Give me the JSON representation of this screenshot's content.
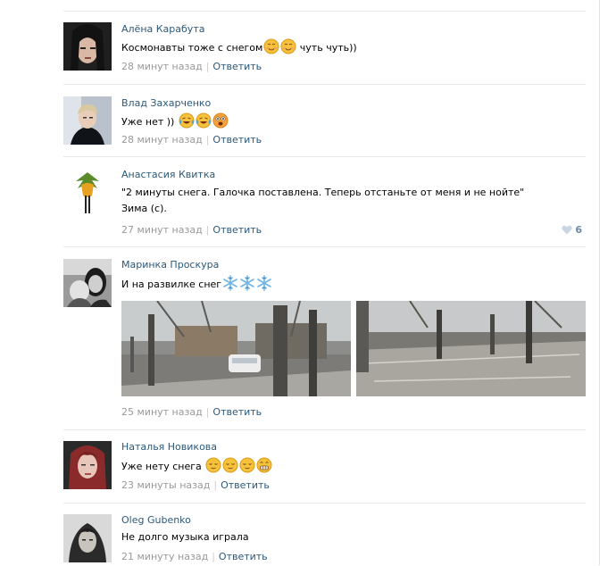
{
  "comments": [
    {
      "author": "Алёна Карабута",
      "text": "Космонавты тоже с снегом",
      "text_after": "чуть чуть))",
      "time": "28 минут назад",
      "reply": "Ответить"
    },
    {
      "author": "Влад Захарченко",
      "text": "Уже нет ))",
      "time": "28 минут назад",
      "reply": "Ответить"
    },
    {
      "author": "Анастасия Квитка",
      "text": "\"2 минуты снега. Галочка поставлена. Теперь отстаньте от меня и не нойте\"",
      "text2": "Зима (с).",
      "time": "27 минут назад",
      "reply": "Ответить",
      "likes": "6"
    },
    {
      "author": "Маринка Проскура",
      "text": "И на развилке снег",
      "time": "25 минут назад",
      "reply": "Ответить"
    },
    {
      "author": "Наталья Новикова",
      "text": "Уже нету снега",
      "time": "23 минуты назад",
      "reply": "Ответить"
    },
    {
      "author": "Oleg Gubenko",
      "text": "Не долго музыка играла",
      "time": "21 минуту назад",
      "reply": "Ответить"
    }
  ],
  "separator": "|",
  "colors": {
    "link": "#2b587a",
    "meta": "#999999",
    "like": "#6b8aa8"
  },
  "icons": [
    "smile-emoji-icon",
    "tears-of-joy-emoji-icon",
    "astonished-emoji-icon",
    "snowflake-icon",
    "relieved-emoji-icon",
    "grimacing-emoji-icon",
    "heart-icon"
  ]
}
